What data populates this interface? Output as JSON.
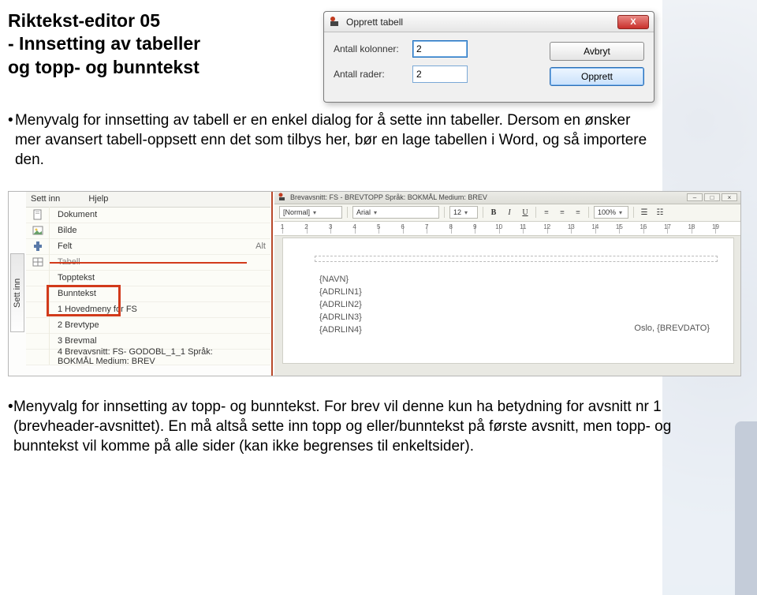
{
  "heading": {
    "line1": "Riktekst-editor 05",
    "line2": "- Innsetting av tabeller",
    "line3": "og topp- og bunntekst"
  },
  "dialog": {
    "title": "Opprett tabell",
    "close_glyph": "X",
    "field_cols_label": "Antall kolonner:",
    "field_cols_value": "2",
    "field_rows_label": "Antall rader:",
    "field_rows_value": "2",
    "btn_cancel": "Avbryt",
    "btn_ok": "Opprett"
  },
  "para1": "Menyvalg for innsetting av tabell er en enkel dialog for å sette inn tabeller. Dersom en ønsker mer avansert tabell-oppsett enn det som tilbys her, bør en lage tabellen i Word, og så importere den.",
  "sidebar": {
    "tab_label": "Sett inn",
    "header_item1": "Sett inn",
    "header_item2": "Hjelp",
    "items": [
      {
        "label": "Dokument",
        "hint": "",
        "icon": "doc"
      },
      {
        "label": "Bilde",
        "hint": "",
        "icon": "img"
      },
      {
        "label": "Felt",
        "hint": "Alt",
        "icon": "field"
      },
      {
        "label": "Tabell",
        "hint": "",
        "icon": "table",
        "struck": true
      },
      {
        "label": "Topptekst",
        "hint": "",
        "icon": ""
      },
      {
        "label": "Bunntekst",
        "hint": "",
        "icon": ""
      },
      {
        "label": "1 Hovedmeny for FS",
        "hint": "",
        "icon": ""
      },
      {
        "label": "2 Brevtype",
        "hint": "",
        "icon": ""
      },
      {
        "label": "3 Brevmal",
        "hint": "",
        "icon": ""
      },
      {
        "label": "4 Brevavsnitt: FS- GODOBL_1_1 Språk: BOKMÅL Medium: BREV",
        "hint": "",
        "icon": ""
      }
    ]
  },
  "editor": {
    "titlebar": "Brevavsnitt: FS - BREVTOPP Språk: BOKMÅL Medium: BREV",
    "style_combo": "[Normal]",
    "font_combo": "Arial",
    "size_combo": "12",
    "zoom_combo": "100%",
    "ruler_ticks": [
      "1",
      "2",
      "3",
      "4",
      "5",
      "6",
      "7",
      "8",
      "9",
      "10",
      "11",
      "12",
      "13",
      "14",
      "15",
      "16",
      "17",
      "18",
      "19"
    ],
    "doc_lines": [
      "{NAVN}",
      "{ADRLIN1}",
      "{ADRLIN2}",
      "{ADRLIN3}",
      "{ADRLIN4}"
    ],
    "doc_right": "Oslo, {BREVDATO}"
  },
  "para2": "Menyvalg for innsetting av topp- og bunntekst. For brev vil denne kun ha betydning for avsnitt nr 1 (brevheader-avsnittet). En må altså sette inn topp og eller/bunntekst på første avsnitt, men topp- og bunntekst vil komme på alle sider (kan ikke begrenses til enkeltsider)."
}
